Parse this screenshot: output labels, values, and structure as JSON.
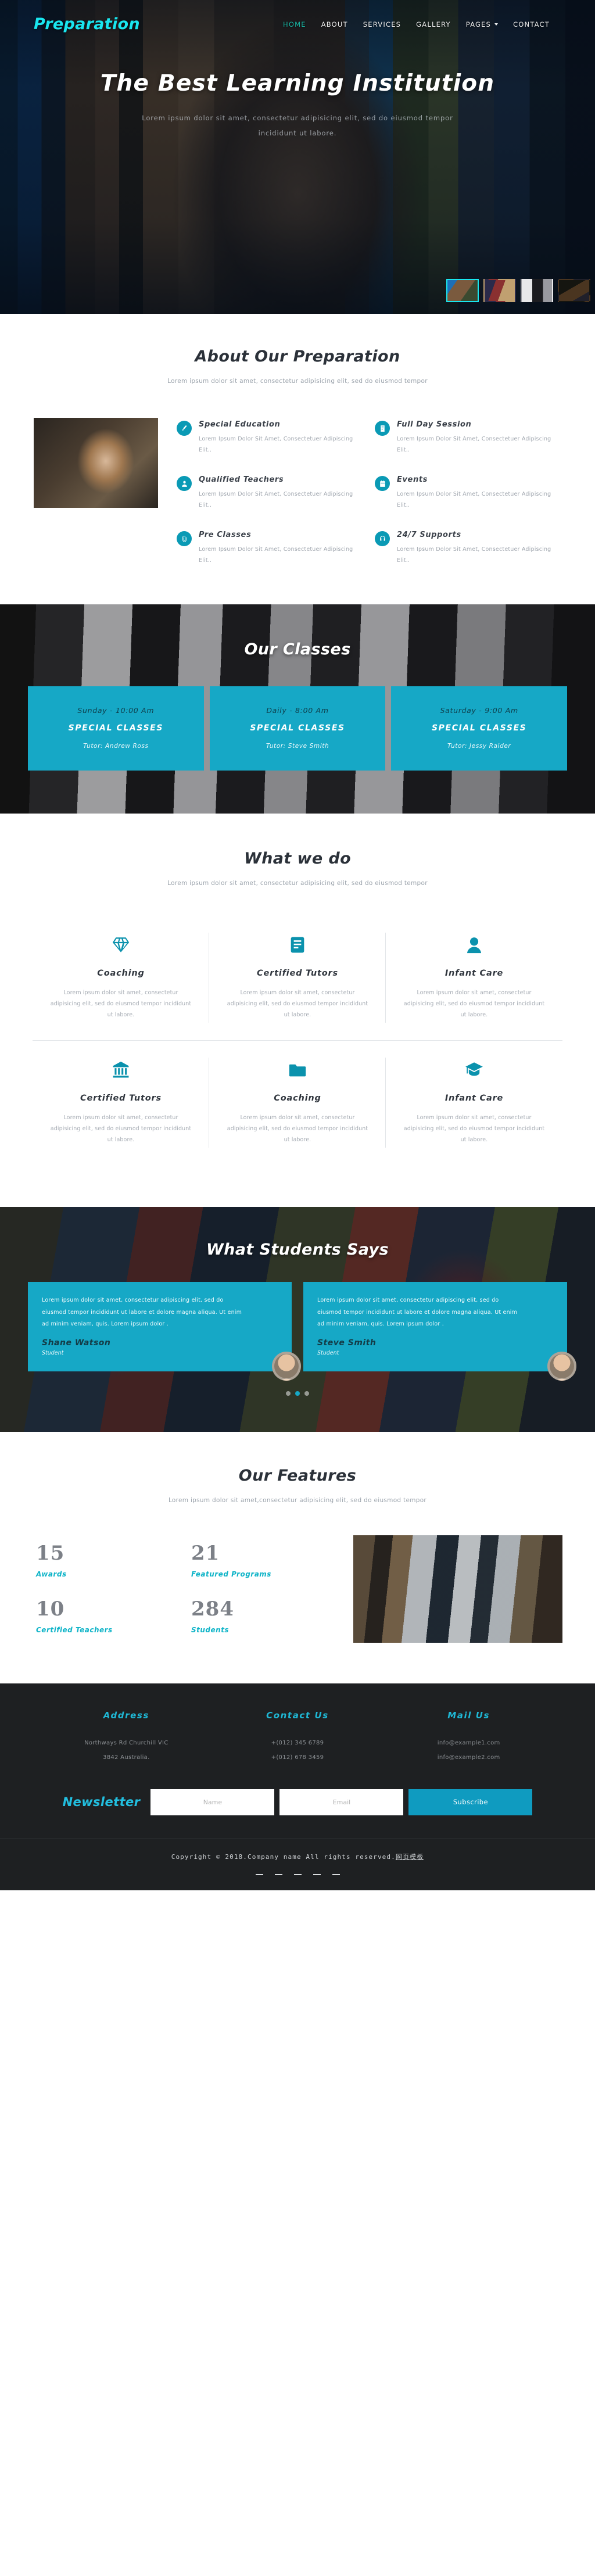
{
  "brand": "Preparation",
  "nav": {
    "items": [
      {
        "label": "HOME",
        "active": true
      },
      {
        "label": "ABOUT",
        "active": false
      },
      {
        "label": "SERVICES",
        "active": false
      },
      {
        "label": "GALLERY",
        "active": false
      },
      {
        "label": "PAGES",
        "active": false,
        "caret": true
      },
      {
        "label": "CONTACT",
        "active": false
      }
    ]
  },
  "hero": {
    "title": "The Best Learning Institution",
    "subtitle": "Lorem ipsum dolor sit amet, consectetur adipisicing elit, sed do eiusmod tempor incididunt ut labore.",
    "thumbnails": [
      {
        "name": "slide-thumb-1",
        "active": true
      },
      {
        "name": "slide-thumb-2",
        "active": false
      },
      {
        "name": "slide-thumb-3",
        "active": false
      },
      {
        "name": "slide-thumb-4",
        "active": false
      }
    ]
  },
  "about": {
    "title": "About Our Preparation",
    "subtitle": "Lorem ipsum dolor sit amet, consectetur adipisicing elit, sed do eiusmod tempor",
    "features": [
      {
        "icon": "brush-icon",
        "title": "Special Education",
        "text": "Lorem Ipsum Dolor Sit Amet, Consectetuer Adipiscing Elit.."
      },
      {
        "icon": "document-icon",
        "title": "Full Day Session",
        "text": "Lorem Ipsum Dolor Sit Amet, Consectetuer Adipiscing Elit.."
      },
      {
        "icon": "user-icon",
        "title": "Qualified Teachers",
        "text": "Lorem Ipsum Dolor Sit Amet, Consectetuer Adipiscing Elit.."
      },
      {
        "icon": "calendar-icon",
        "title": "Events",
        "text": "Lorem Ipsum Dolor Sit Amet, Consectetuer Adipiscing Elit.."
      },
      {
        "icon": "paperclip-icon",
        "title": "Pre Classes",
        "text": "Lorem Ipsum Dolor Sit Amet, Consectetuer Adipiscing Elit.."
      },
      {
        "icon": "support-icon",
        "title": "24/7 Supports",
        "text": "Lorem Ipsum Dolor Sit Amet, Consectetuer Adipiscing Elit.."
      }
    ]
  },
  "classes": {
    "title": "Our Classes",
    "cards": [
      {
        "time": "Sunday - 10:00 Am",
        "name": "SPECIAL CLASSES",
        "tutor": "Tutor: Andrew Ross"
      },
      {
        "time": "Daily - 8:00 Am",
        "name": "SPECIAL CLASSES",
        "tutor": "Tutor: Steve Smith"
      },
      {
        "time": "Saturday - 9:00 Am",
        "name": "SPECIAL CLASSES",
        "tutor": "Tutor: Jessy Raider"
      }
    ]
  },
  "whatwedo": {
    "title": "What we do",
    "subtitle": "Lorem ipsum dolor sit amet, consectetur adipisicing elit, sed do eiusmod tempor",
    "cards": [
      {
        "icon": "diamond-icon",
        "title": "Coaching",
        "text": "Lorem ipsum dolor sit amet, consectetur adipisicing elit, sed do eiusmod tempor incididunt ut labore."
      },
      {
        "icon": "book-icon",
        "title": "Certified Tutors",
        "text": "Lorem ipsum dolor sit amet, consectetur adipisicing elit, sed do eiusmod tempor incididunt ut labore."
      },
      {
        "icon": "baby-icon",
        "title": "Infant Care",
        "text": "Lorem ipsum dolor sit amet, consectetur adipisicing elit, sed do eiusmod tempor incididunt ut labore."
      },
      {
        "icon": "bank-icon",
        "title": "Certified Tutors",
        "text": "Lorem ipsum dolor sit amet, consectetur adipisicing elit, sed do eiusmod tempor incididunt ut labore."
      },
      {
        "icon": "folder-icon",
        "title": "Coaching",
        "text": "Lorem ipsum dolor sit amet, consectetur adipisicing elit, sed do eiusmod tempor incididunt ut labore."
      },
      {
        "icon": "graduation-cap-icon",
        "title": "Infant Care",
        "text": "Lorem ipsum dolor sit amet, consectetur adipisicing elit, sed do eiusmod tempor incididunt ut labore."
      }
    ]
  },
  "testimonials": {
    "title": "What Students Says",
    "cards": [
      {
        "text": "Lorem ipsum dolor sit amet, consectetur adipiscing elit, sed do eiusmod tempor incididunt ut labore et dolore magna aliqua. Ut enim ad minim veniam, quis. Lorem ipsum dolor .",
        "name": "Shane Watson",
        "role": "Student"
      },
      {
        "text": "Lorem ipsum dolor sit amet, consectetur adipiscing elit, sed do eiusmod tempor incididunt ut labore et dolore magna aliqua. Ut enim ad minim veniam, quis. Lorem ipsum dolor .",
        "name": "Steve Smith",
        "role": "Student"
      }
    ],
    "dots": [
      false,
      true,
      false
    ]
  },
  "features": {
    "title": "Our Features",
    "subtitle": "Lorem ipsum dolor sit amet,consectetur adipisicing elit, sed do eiusmod tempor",
    "counters": [
      {
        "number": "15",
        "label": "Awards"
      },
      {
        "number": "21",
        "label": "Featured Programs"
      },
      {
        "number": "10",
        "label": "Certified Teachers"
      },
      {
        "number": "284",
        "label": "Students"
      }
    ]
  },
  "footer": {
    "columns": [
      {
        "heading": "Address",
        "lines": [
          "Northways Rd Churchill VIC",
          "3842 Australia."
        ]
      },
      {
        "heading": "Contact Us",
        "lines": [
          "+(012) 345 6789",
          "+(012) 678 3459"
        ]
      },
      {
        "heading": "Mail Us",
        "lines": [
          "info@example1.com",
          "info@example2.com"
        ]
      }
    ],
    "newsletter": {
      "title": "Newsletter",
      "name_placeholder": "Name",
      "email_placeholder": "Email",
      "button": "Subscribe"
    },
    "copyright": "Copyright © 2018.Company name All rights reserved.",
    "copyright_link": "网页模板"
  }
}
